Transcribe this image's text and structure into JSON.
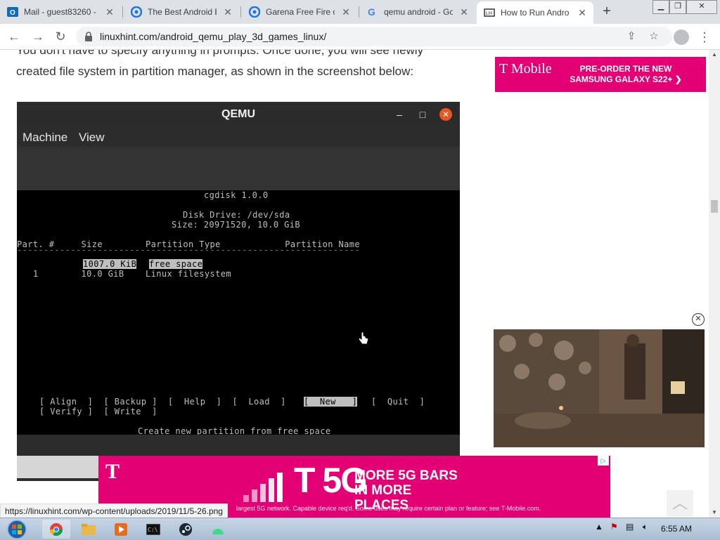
{
  "browser": {
    "tabs": [
      {
        "title": "Mail - guest83260 -",
        "icon": "outlook-icon",
        "color": "#0f6cbd"
      },
      {
        "title": "The Best Android E",
        "icon": "site-icon",
        "color": "#1a73e8"
      },
      {
        "title": "Garena Free Fire or",
        "icon": "site-icon",
        "color": "#1a73e8"
      },
      {
        "title": "qemu android - Go",
        "icon": "google-icon",
        "color": "#4285f4"
      },
      {
        "title": "How to Run Andro",
        "icon": "linuxhint-icon",
        "color": "#333333",
        "active": true
      }
    ],
    "new_tab": "+",
    "url": "linuxhint.com/android_qemu_play_3d_games_linux/"
  },
  "article": {
    "text": "You don't have to specify anything in prompts. Once done, you will see newly created file system in partition manager, as shown in the screenshot below:"
  },
  "qemu": {
    "title": "QEMU",
    "menu": [
      "Machine",
      "View"
    ],
    "terminal": {
      "line1": "cgdisk 1.0.0",
      "line2": "Disk Drive: /dev/sda",
      "line3": "Size: 20971520, 10.0 GiB",
      "header": "Part. #     Size        Partition Type            Partition Name",
      "divider": "----------------------------------------------------------------",
      "row1_size": "1007.0 KiB",
      "row1_type": "free space",
      "row2": "   1        10.0 GiB    Linux filesystem",
      "cmds1a": "[ Align  ]  [ Backup ]  [  Help  ]  [  Load  ]",
      "cmds1b": "[  New   ]",
      "cmds1c": "[  Quit  ]",
      "cmds2": "[ Verify ]  [ Write  ]",
      "hint": "Create new partition from free space"
    }
  },
  "ads": {
    "top_logo": "T Mobile",
    "top_cta": "PRE-ORDER THE NEW SAMSUNG GALAXY S22+ ❯",
    "bottom_t": "T",
    "bottom_big": "T 5G",
    "bottom_headline": "MORE 5G BARS IN MORE PLACES",
    "bottom_fine": "largest 5G network. Capable device req'd. Some uses may require certain plan or feature; see T-Mobile.com.",
    "brand_color": "#e20074"
  },
  "status_url": "https://linuxhint.com/wp-content/uploads/2019/11/5-26.png",
  "taskbar": {
    "clock": "6:55 AM"
  }
}
